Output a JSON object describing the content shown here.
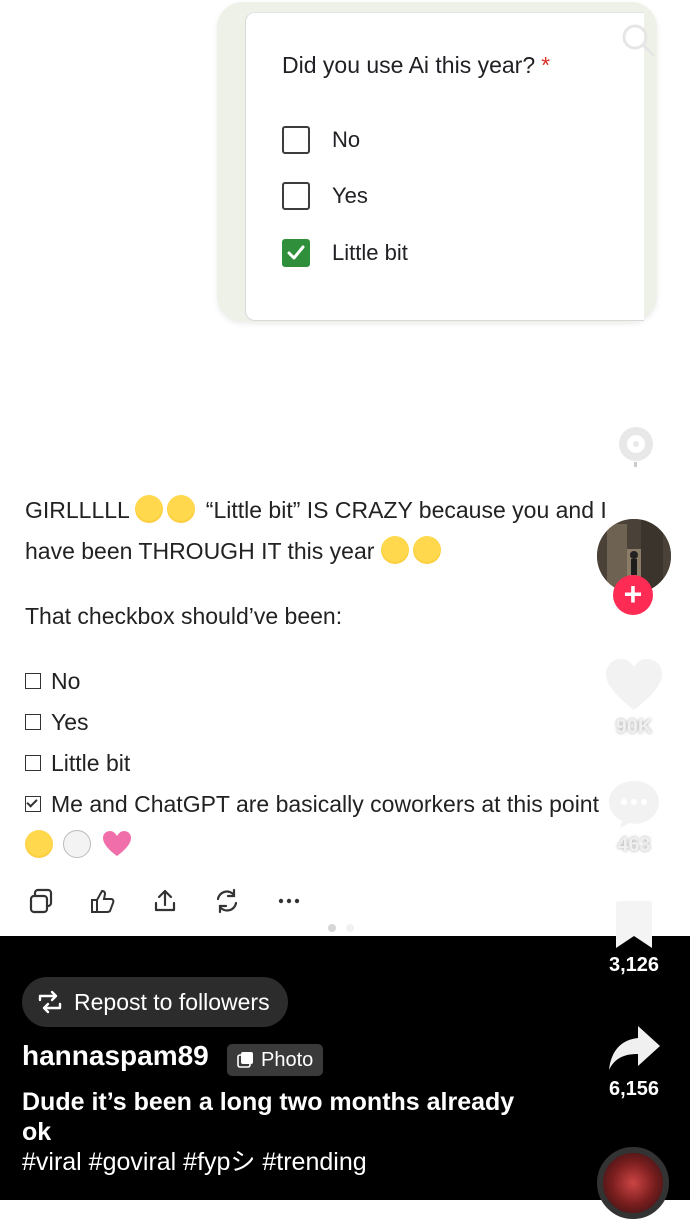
{
  "form": {
    "question": "Did you use Ai this year?",
    "required_mark": "*",
    "options": [
      {
        "label": "No",
        "checked": false
      },
      {
        "label": "Yes",
        "checked": false
      },
      {
        "label": "Little bit",
        "checked": true
      }
    ]
  },
  "post": {
    "line1": "GIRLLLLL",
    "line1b": "“Little bit” IS CRAZY because you and I",
    "line2": "have been THROUGH IT this year",
    "line3": "That checkbox should’ve been:",
    "list": [
      {
        "label": "No",
        "checked": false
      },
      {
        "label": "Yes",
        "checked": false
      },
      {
        "label": "Little bit",
        "checked": false
      },
      {
        "label": "Me and ChatGPT are basically coworkers at this point",
        "checked": true
      }
    ]
  },
  "actions": [
    "copy-icon",
    "thumbs-icon",
    "share-upload-icon",
    "regenerate-icon",
    "more-icon"
  ],
  "repost": {
    "label": "Repost to followers"
  },
  "author": {
    "username": "hannaspam89",
    "badge": "Photo"
  },
  "caption": "Dude it’s been a long two months already ok",
  "hashtags": "#viral #goviral #fypシ #trending",
  "rail": {
    "likes": "90K",
    "comments": "463",
    "saves": "3,126",
    "shares": "6,156"
  },
  "colors": {
    "check_green": "#2f8f3a",
    "follow_red": "#fe2c55",
    "bottom_bg": "#000000"
  }
}
